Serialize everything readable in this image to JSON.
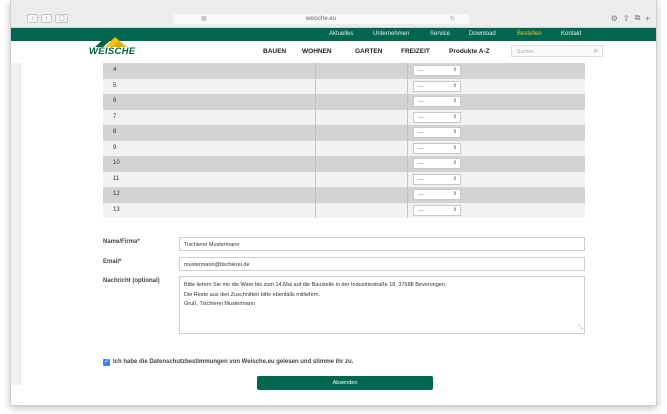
{
  "browser": {
    "url": "weische.eu",
    "nav_back": "‹",
    "nav_forward": "›",
    "sidebar": "▢",
    "grid_icon": "▦",
    "reload_icon": "↻",
    "right_icons": [
      "⚙",
      "⇪",
      "⧉",
      "+"
    ]
  },
  "topnav": {
    "items": [
      "Aktuelles",
      "Unternehmen",
      "Service",
      "Download",
      "Bestellen",
      "Kontakt"
    ],
    "active": "Bestellen",
    "bg": "#00664f",
    "active_color": "#f0c419"
  },
  "logo": {
    "text": "WEISCHE"
  },
  "mainnav": {
    "items": [
      "BAUEN",
      "WOHNEN",
      "GARTEN",
      "FREIZEIT",
      "Produkte A-Z"
    ]
  },
  "search": {
    "placeholder": "Suchen",
    "icon": "search-icon"
  },
  "table": {
    "rows": [
      {
        "num": "4",
        "select": "---"
      },
      {
        "num": "5",
        "select": "---"
      },
      {
        "num": "6",
        "select": "---"
      },
      {
        "num": "7",
        "select": "---"
      },
      {
        "num": "8",
        "select": "---"
      },
      {
        "num": "9",
        "select": "---"
      },
      {
        "num": "10",
        "select": "---"
      },
      {
        "num": "11",
        "select": "---"
      },
      {
        "num": "12",
        "select": "---"
      },
      {
        "num": "13",
        "select": "---"
      }
    ],
    "select_arrow": "⇕"
  },
  "form": {
    "name_label": "Name/Firma*",
    "name_value": "Tischlerei Mustermann",
    "email_label": "Email*",
    "email_value": "mustermann@tischlerei.de",
    "message_label": "Nachricht (optional)",
    "message_lines": [
      "Bitte liefern Sie mir die Ware bis zum 14.Mai auf die Baustelle in der Industriestraße 18, 37688 Beverungen.",
      "Die Reste aus den Zuschnitten bitte ebenfalls mitliefern.",
      "Gruß, Tischlerei Mustermann"
    ],
    "consent_text": "Ich habe die Datenschutzbestimmungen von Weische.eu gelesen und stimme ihr zu.",
    "consent_checked": "✓",
    "submit_label": "Absenden"
  }
}
